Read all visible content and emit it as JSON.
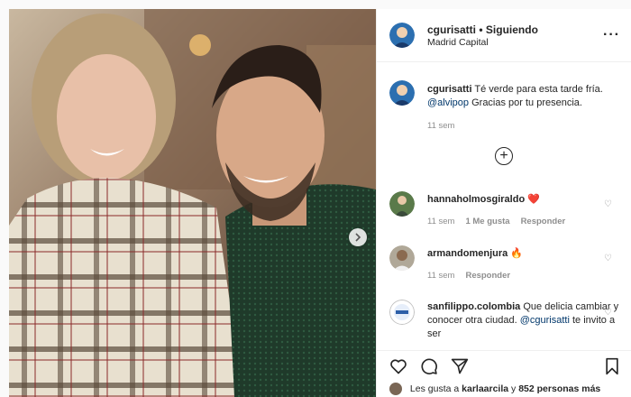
{
  "post": {
    "username": "cgurisatti",
    "separator": "•",
    "follow_status": "Siguiendo",
    "location": "Madrid Capital",
    "more": "···"
  },
  "caption": {
    "username": "cgurisatti",
    "text": "Té verde para esta tarde fría.",
    "mention": "@alvipop",
    "text2": "Gracias por tu presencia.",
    "time": "11 sem"
  },
  "comments": [
    {
      "username": "hannaholmosgiraldo",
      "text": "❤️",
      "time": "11 sem",
      "likes": "1 Me gusta",
      "reply": "Responder"
    },
    {
      "username": "armandomenjura",
      "text": "🔥",
      "time": "11 sem",
      "reply": "Responder"
    },
    {
      "username": "sanfilippo.colombia",
      "text": "Que delicia cambiar y conocer otra ciudad.",
      "mention": "@cgurisatti",
      "text2": "te invito a ser"
    }
  ],
  "likes_line": {
    "prefix": "Les gusta a",
    "user": "karlaarcila",
    "middle": "y",
    "count": "852 personas más"
  },
  "colors": {
    "link": "#00376b",
    "muted": "#8e8e8e",
    "heart": "#ed4956"
  },
  "icons": [
    "more-icon",
    "plus-circle-icon",
    "heart-icon",
    "comment-icon",
    "share-icon",
    "bookmark-icon",
    "chevron-right-icon"
  ]
}
